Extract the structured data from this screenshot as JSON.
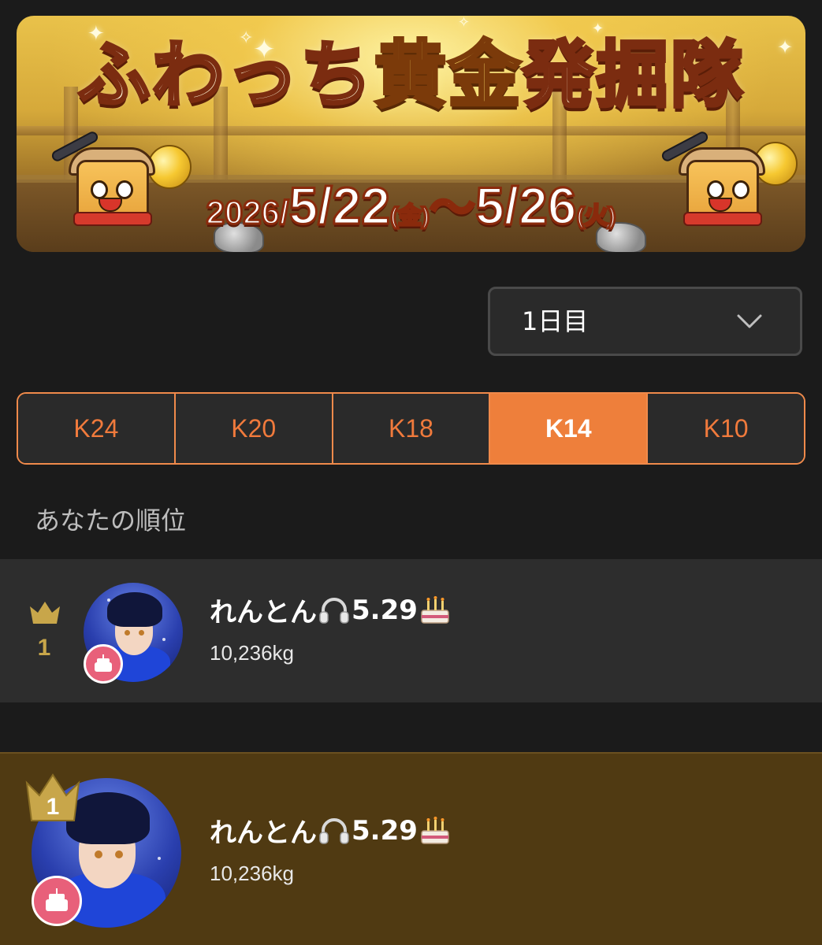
{
  "banner": {
    "title_part1": "ふわっち",
    "title_part2": "黄金",
    "title_part3": "発掘隊",
    "date_start_year": "2026/",
    "date_start_md": "5/22",
    "date_start_dow": "(金)",
    "date_sep": "〜",
    "date_end_md": "5/26",
    "date_end_dow": "(火)"
  },
  "day_select": {
    "selected": "1日目"
  },
  "tabs": [
    {
      "label": "K24",
      "active": false
    },
    {
      "label": "K20",
      "active": false
    },
    {
      "label": "K18",
      "active": false
    },
    {
      "label": "K14",
      "active": true
    },
    {
      "label": "K10",
      "active": false
    }
  ],
  "my_rank": {
    "section_label": "あなたの順位",
    "rank": "1",
    "name": "れんとん",
    "name_suffix": "5.29",
    "score": "10,236kg",
    "icons": [
      "headphones-icon",
      "birthday-cake-icon"
    ]
  },
  "ranking": [
    {
      "rank": "1",
      "name": "れんとん",
      "name_suffix": "5.29",
      "score": "10,236kg"
    }
  ],
  "colors": {
    "accent": "#ee7f3b",
    "background": "#1b1b1b",
    "gold_row": "#503a12",
    "crown": "#c8a64a"
  }
}
